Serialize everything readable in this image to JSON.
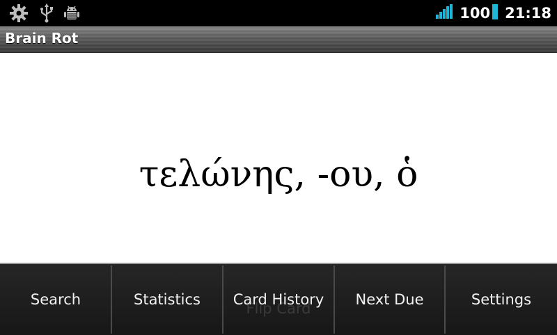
{
  "status_bar": {
    "icons": [
      "settings-gear-icon",
      "usb-icon",
      "android-debug-icon"
    ],
    "battery": "100",
    "time": "21:18",
    "signal_color": "#1fb5d6"
  },
  "app": {
    "title": "Brain Rot"
  },
  "card": {
    "word": "τελώνης, -ου, ὁ"
  },
  "menu": {
    "items": [
      "Search",
      "Statistics",
      "Card History",
      "Next Due",
      "Settings"
    ],
    "hidden_button": "Flip Card"
  }
}
